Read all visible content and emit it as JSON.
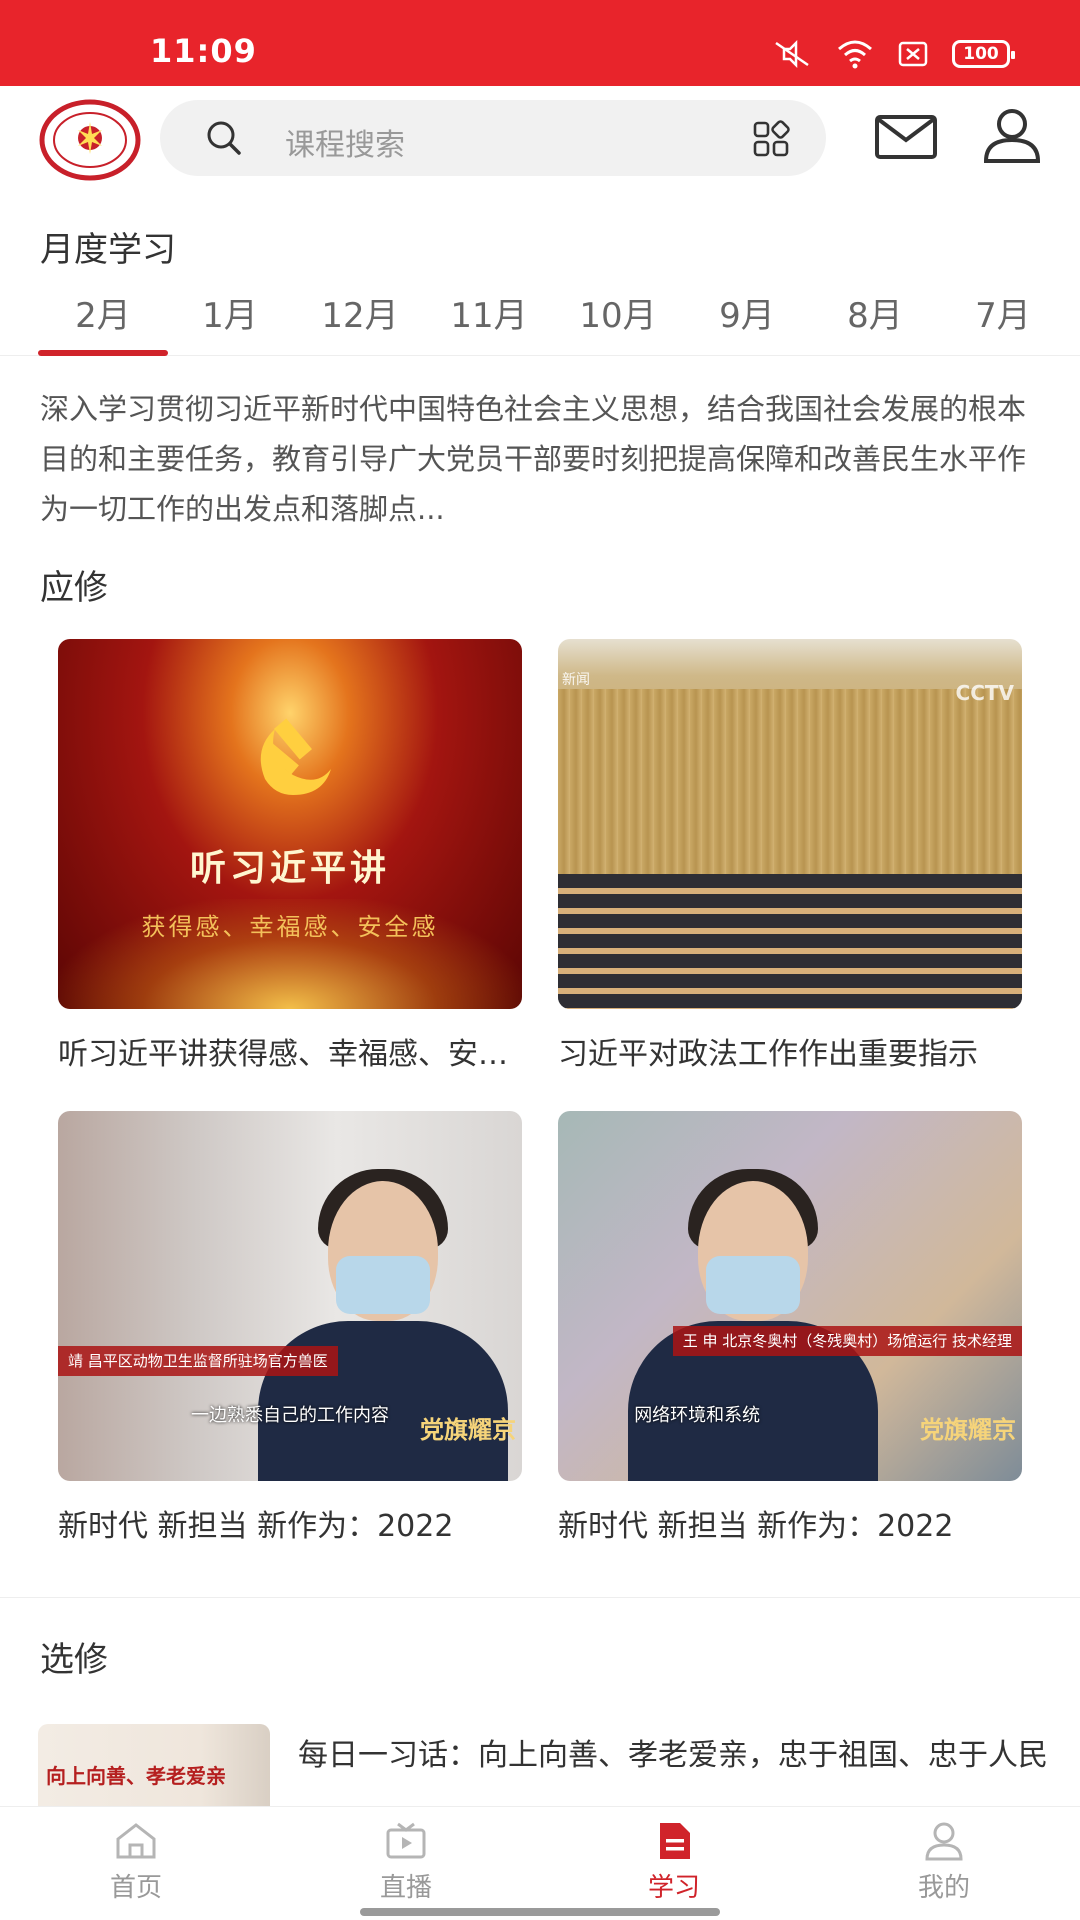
{
  "status_bar": {
    "time": "11:09",
    "battery": "100",
    "icons": [
      "mute-icon",
      "wifi-icon",
      "sim-off-icon",
      "battery-icon"
    ],
    "color": "#e8242b"
  },
  "header": {
    "logo": "党员干部现代远程教育 北京",
    "search_placeholder": "课程搜索",
    "icons": [
      "search-icon",
      "grid-scan-icon",
      "mail-icon",
      "user-icon"
    ]
  },
  "monthly": {
    "title": "月度学习",
    "tabs": [
      "2月",
      "1月",
      "12月",
      "11月",
      "10月",
      "9月",
      "8月",
      "7月"
    ],
    "active_index": 0,
    "description": "深入学习贯彻习近平新时代中国特色社会主义思想，结合我国社会发展的根本目的和主要任务，教育引导广大党员干部要时刻把提高保障和改善民生水平作为一切工作的出发点和落脚点..."
  },
  "required": {
    "title": "应修",
    "courses": [
      {
        "title": "听习近平讲获得感、幸福感、安全感",
        "thumb_text": "听习近平讲",
        "thumb_subtext": "获得感、幸福感、安全感"
      },
      {
        "title": "习近平对政法工作作出重要指示",
        "thumb_logo": "CCTV",
        "thumb_tag": "新闻"
      },
      {
        "title": "新时代 新担当 新作为：2022",
        "thumb_name_bar": "靖  昌平区动物卫生监督所驻场官方兽医",
        "thumb_subtitle": "一边熟悉自己的工作内容",
        "thumb_brand": "党旗耀京"
      },
      {
        "title": "新时代 新担当 新作为：2022",
        "thumb_name_bar": "王 申  北京冬奥村（冬残奥村）场馆运行 技术经理",
        "thumb_subtitle": "网络环境和系统",
        "thumb_brand": "党旗耀京"
      }
    ]
  },
  "elective": {
    "title": "选修",
    "items": [
      {
        "title": "每日一习话：向上向善、孝老爱亲，忠于祖国、忠于人民",
        "thumb_text": "向上向善、孝老爱亲"
      }
    ]
  },
  "tabbar": {
    "items": [
      {
        "label": "首页",
        "icon": "home-icon"
      },
      {
        "label": "直播",
        "icon": "live-tv-icon"
      },
      {
        "label": "学习",
        "icon": "study-doc-icon"
      },
      {
        "label": "我的",
        "icon": "profile-icon"
      }
    ],
    "active_index": 2,
    "active_color": "#d0232a"
  }
}
